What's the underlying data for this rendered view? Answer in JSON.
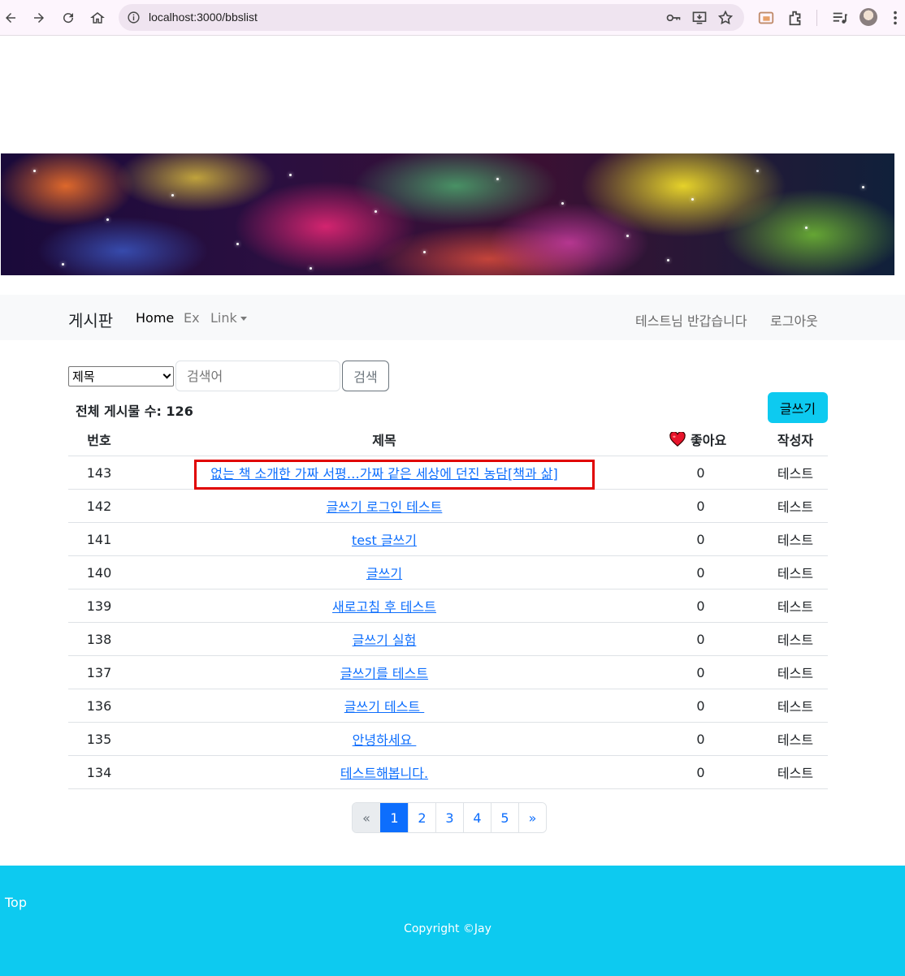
{
  "browser": {
    "url": "localhost:3000/bbslist"
  },
  "navbar": {
    "brand": "게시판",
    "home": "Home",
    "ex": "Ex",
    "link": "Link",
    "greeting": "테스트님 반갑습니다",
    "logout": "로그아웃"
  },
  "search": {
    "select_value": "제목",
    "placeholder": "검색어",
    "button": "검색"
  },
  "board": {
    "total": "전체 게시물 수: 126",
    "write_button": "글쓰기",
    "headers": {
      "no": "번호",
      "title": "제목",
      "likes": "좋아요",
      "writer": "작성자"
    },
    "rows": [
      {
        "no": "143",
        "title": "없는 책 소개한 가짜 서평…가짜 같은 세상에 던진 농담[책과 삶]",
        "likes": "0",
        "writer": "테스트"
      },
      {
        "no": "142",
        "title": "글쓰기 로그인 테스트",
        "likes": "0",
        "writer": "테스트"
      },
      {
        "no": "141",
        "title": "test 글쓰기",
        "likes": "0",
        "writer": "테스트"
      },
      {
        "no": "140",
        "title": "글쓰기",
        "likes": "0",
        "writer": "테스트"
      },
      {
        "no": "139",
        "title": "새로고침 후 테스트",
        "likes": "0",
        "writer": "테스트"
      },
      {
        "no": "138",
        "title": "글쓰기 실험",
        "likes": "0",
        "writer": "테스트"
      },
      {
        "no": "137",
        "title": "글쓰기를 테스트",
        "likes": "0",
        "writer": "테스트"
      },
      {
        "no": "136",
        "title": "글쓰기 테스트 ",
        "likes": "0",
        "writer": "테스트"
      },
      {
        "no": "135",
        "title": "안녕하세요 ",
        "likes": "0",
        "writer": "테스트"
      },
      {
        "no": "134",
        "title": "테스트해봅니다.",
        "likes": "0",
        "writer": "테스트"
      }
    ]
  },
  "pagination": {
    "prev": "«",
    "pages": [
      "1",
      "2",
      "3",
      "4",
      "5"
    ],
    "current": "1",
    "next": "»"
  },
  "footer": {
    "top": "Top",
    "copyright": "Copyright ©Jay"
  },
  "colors": {
    "accent": "#0dcaf0",
    "link": "#0d6efd",
    "highlight": "#e00000"
  }
}
